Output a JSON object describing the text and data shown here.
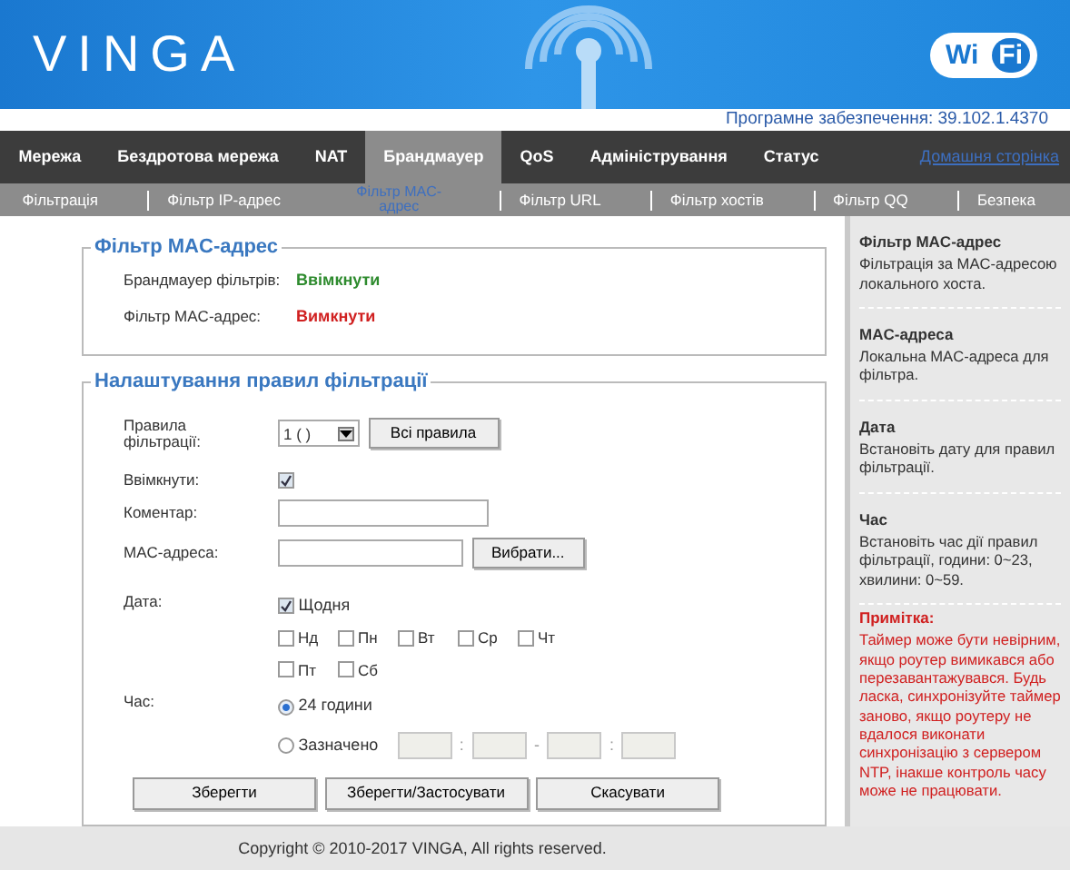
{
  "header": {
    "logo": "VINGA",
    "wifi_badge": [
      "Wi",
      "Fi"
    ]
  },
  "firmware": "Програмне забезпечення: 39.102.1.4370",
  "nav": {
    "items": [
      {
        "label": "Мережа",
        "selected": false
      },
      {
        "label": "Бездротова мережа",
        "selected": false
      },
      {
        "label": "NAT",
        "selected": false
      },
      {
        "label": "Брандмауер",
        "selected": true
      },
      {
        "label": "QoS",
        "selected": false
      },
      {
        "label": "Адміністрування",
        "selected": false
      },
      {
        "label": "Статус",
        "selected": false
      }
    ],
    "home_link": "Домашня сторінка"
  },
  "subnav": {
    "items": [
      {
        "label": "Фільтрація",
        "selected": false
      },
      {
        "label": "Фільтр IP-адрес",
        "selected": false
      },
      {
        "label": "Фільтр MAC-адрес",
        "selected": true
      },
      {
        "label": "Фільтр URL",
        "selected": false
      },
      {
        "label": "Фільтр хостів",
        "selected": false
      },
      {
        "label": "Фільтр QQ",
        "selected": false
      },
      {
        "label": "Безпека",
        "selected": false
      }
    ]
  },
  "status_box": {
    "title": "Фільтр MAC-адрес",
    "rows": [
      {
        "label": "Брандмауер фільтрів:",
        "value": "Ввімкнути",
        "enabled": true
      },
      {
        "label": "Фільтр MAC-адрес:",
        "value": "Вимкнути",
        "enabled": false
      }
    ]
  },
  "rules_box": {
    "title": "Налаштування правил фільтрації",
    "rule_select": {
      "label": "Правила фільтрації:",
      "value": "1 ( )",
      "button": "Всі правила"
    },
    "enabled": {
      "label": "Ввімкнути:",
      "checked": true
    },
    "comment": {
      "label": "Коментар:"
    },
    "mac": {
      "label": "MAC-адреса:",
      "button": "Вибрати..."
    },
    "date": {
      "label": "Дата:",
      "daily": {
        "label": "Щодня",
        "checked": true
      },
      "days": [
        {
          "label": "Нд",
          "checked": false
        },
        {
          "label": "Пн",
          "checked": false
        },
        {
          "label": "Вт",
          "checked": false
        },
        {
          "label": "Ср",
          "checked": false
        },
        {
          "label": "Чт",
          "checked": false
        },
        {
          "label": "Пт",
          "checked": false
        },
        {
          "label": "Сб",
          "checked": false
        }
      ]
    },
    "time": {
      "label": "Час:",
      "options": [
        {
          "label": "24 години",
          "selected": true
        },
        {
          "label": "Зазначено",
          "selected": false
        }
      ],
      "separators": [
        ":",
        "-",
        ":"
      ],
      "disabled": true
    },
    "buttons": [
      "Зберегти",
      "Зберегти/Застосувати",
      "Скасувати"
    ]
  },
  "help": {
    "sections": [
      {
        "title": "Фільтр MAC-адрес",
        "text": "Фільтрація за MAC-адресою локального хоста."
      },
      {
        "title": "MAC-адреса",
        "text": "Локальна MAC-адреса для фільтра."
      },
      {
        "title": "Дата",
        "text": "Встановіть дату для правил фільтрації."
      },
      {
        "title": "Час",
        "text": "Встановіть час дії правил фільтрації, години: 0~23, хвилини: 0~59."
      }
    ],
    "note": {
      "title": "Примітка:",
      "text": "Таймер може бути невірним, якщо роутер вимикався або перезавантажувався. Будь ласка, синхронізуйте таймер заново, якщо роутеру не вдалося виконати синхронізацію з сервером NTP, інакше контроль часу може не працювати."
    }
  },
  "footer": "Copyright © 2010-2017 VINGA, All rights reserved."
}
